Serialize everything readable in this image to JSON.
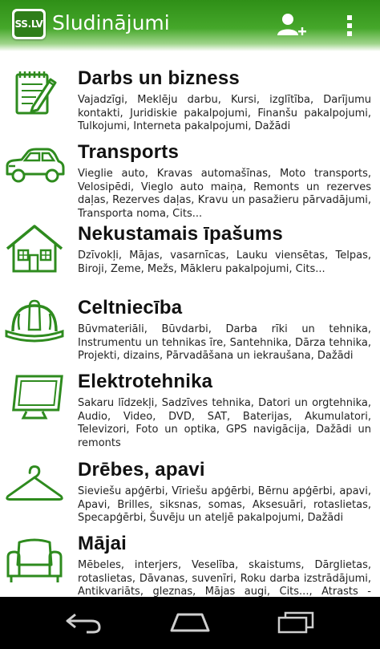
{
  "app": {
    "logo_text": "SS.LV",
    "title": "Sludinājumi",
    "add_user_icon": "add-user-icon",
    "overflow_icon": "overflow-menu-icon"
  },
  "colors": {
    "appbar_green": "#3a9a20",
    "icon_green": "#2e8b1e",
    "navbar": "#000000"
  },
  "categories": [
    {
      "title": "Darbs un bizness",
      "icon": "notepad-pencil-icon",
      "description": "Vajadzīgi, Meklēju darbu, Kursi, izglītība, Darījumu kontakti, Juridiskie pakalpojumi, Finanšu pakalpojumi, Tulkojumi, Interneta pakalpojumi, Dažādi"
    },
    {
      "title": "Transports",
      "icon": "car-icon",
      "description": "Vieglie auto, Kravas automašīnas, Moto transports, Velosipēdi, Vieglo auto maiņa, Remonts un rezerves daļas, Rezerves daļas, Kravu un pasažieru pārvadājumi, Transporta noma, Cits..."
    },
    {
      "title": "Nekustamais īpašums",
      "icon": "house-icon",
      "description": "Dzīvokļi, Mājas, vasarnīcas, Lauku viensētas, Telpas, Biroji, Zeme, Mežs, Mākleru pakalpojumi, Cits..."
    },
    {
      "title": "Celtniecība",
      "icon": "hard-hat-icon",
      "description": "Būvmateriāli, Būvdarbi, Darba rīki un tehnika, Instrumentu un tehnikas īre, Santehnika, Dārza tehnika, Projekti, dizains, Pārvadāšana un iekraušana, Dažādi"
    },
    {
      "title": "Elektrotehnika",
      "icon": "monitor-icon",
      "description": "Sakaru līdzekļi, Sadzīves tehnika, Datori un orgtehnika, Audio, Video, DVD, SAT, Baterijas, Akumulatori, Televizori, Foto un optika, GPS navigācija, Dažādi un remonts"
    },
    {
      "title": "Drēbes, apavi",
      "icon": "hanger-icon",
      "description": "Sieviešu apģērbi, Vīriešu apģērbi, Bērnu apģērbi, apavi, Apavi, Brilles, siksnas, somas, Aksesuāri, rotaslietas, Specapģērbi, Šuvēju un ateljē pakalpojumi, Dažādi"
    },
    {
      "title": "Mājai",
      "icon": "armchair-icon",
      "description": "Mēbeles, interjers, Veselība, skaistums, Dārglietas, rotaslietas, Dāvanas, suvenīri, Roku darba izstrādājumi, Antikvariāts, gleznas, Mājas augi, Cits..., Atrasts - pazaudēts"
    }
  ],
  "navbar": {
    "back_icon": "back-icon",
    "home_icon": "home-icon",
    "recents_icon": "recent-apps-icon"
  }
}
